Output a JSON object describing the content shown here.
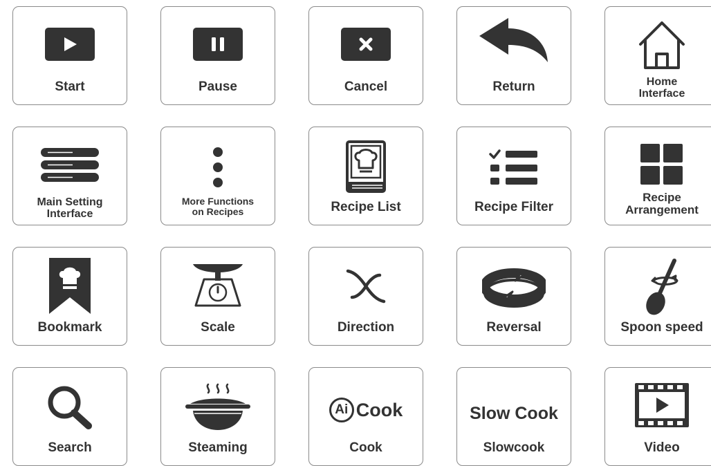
{
  "colors": {
    "icon": "#333333",
    "border": "#8a8a8a",
    "background": "#ffffff"
  },
  "tiles": {
    "start": {
      "icon": "play-icon",
      "label": "Start"
    },
    "pause": {
      "icon": "pause-icon",
      "label": "Pause"
    },
    "cancel": {
      "icon": "close-icon",
      "label": "Cancel"
    },
    "return": {
      "icon": "return-arrow-icon",
      "label": "Return"
    },
    "home": {
      "icon": "home-icon",
      "label_lines": [
        "Home",
        "Interface"
      ]
    },
    "main_setting": {
      "icon": "settings-bars-icon",
      "label_lines": [
        "Main Setting",
        "Interface"
      ]
    },
    "more_functions": {
      "icon": "more-vertical-icon",
      "label_lines": [
        "More Functions",
        "on Recipes"
      ]
    },
    "recipe_list": {
      "icon": "recipe-book-icon",
      "label": "Recipe List"
    },
    "recipe_filter": {
      "icon": "checklist-filter-icon",
      "label": "Recipe Filter"
    },
    "recipe_arrangement": {
      "icon": "grid-icon",
      "label_lines": [
        "Recipe",
        "Arrangement"
      ]
    },
    "bookmark": {
      "icon": "bookmark-chef-icon",
      "label": "Bookmark"
    },
    "scale": {
      "icon": "scale-icon",
      "label": "Scale"
    },
    "direction": {
      "icon": "blade-direction-icon",
      "label": "Direction"
    },
    "reversal": {
      "icon": "reversal-icon",
      "label": "Reversal"
    },
    "spoon_speed": {
      "icon": "spoon-speed-icon",
      "label": "Spoon speed"
    },
    "search": {
      "icon": "search-icon",
      "label": "Search"
    },
    "steaming": {
      "icon": "steaming-pot-icon",
      "label": "Steaming"
    },
    "cook": {
      "icon": "ai-cook-icon",
      "badge": "Ai",
      "wordmark": "Cook",
      "label": "Cook"
    },
    "slowcook": {
      "icon": "slow-cook-icon",
      "wordmark": "Slow Cook",
      "label": "Slowcook"
    },
    "video": {
      "icon": "video-film-icon",
      "label": "Video"
    }
  }
}
